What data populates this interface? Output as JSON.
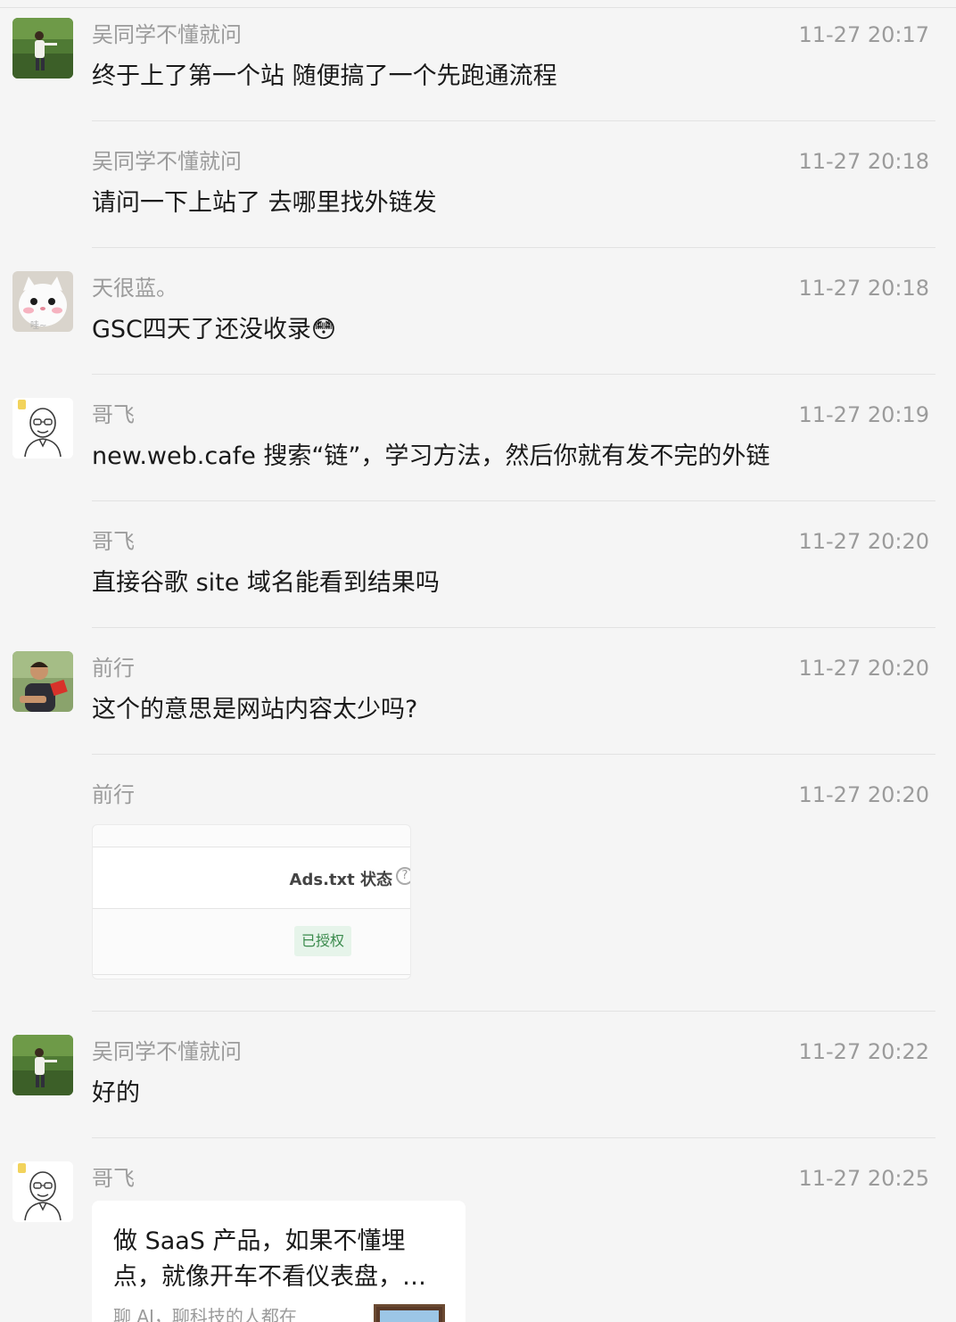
{
  "messages": [
    {
      "sender": "吴同学不懂就问",
      "time": "11-27 20:17",
      "text": "终于上了第一个站 随便搞了一个先跑通流程",
      "avatar": "photo-avatar-wu"
    },
    {
      "sender": "吴同学不懂就问",
      "time": "11-27 20:18",
      "text": "请问一下上站了 去哪里找外链发"
    },
    {
      "sender": "天很蓝。",
      "time": "11-27 20:18",
      "text": "GSC四天了还没收录",
      "emoji": "😳",
      "avatar": "cat-avatar"
    },
    {
      "sender": "哥飞",
      "time": "11-27 20:19",
      "text": "new.web.cafe 搜索“链”，学习方法，然后你就有发不完的外链",
      "avatar": "cartoon-avatar-gefei"
    },
    {
      "sender": "哥飞",
      "time": "11-27 20:20",
      "text": "直接谷歌 site 域名能看到结果吗"
    },
    {
      "sender": "前行",
      "time": "11-27 20:20",
      "text": "这个的意思是网站内容太少吗?",
      "avatar": "photo-avatar-qianxing"
    },
    {
      "sender": "前行",
      "time": "11-27 20:20",
      "image": {
        "label": "Ads.txt 状态",
        "badge": "已授权"
      }
    },
    {
      "sender": "吴同学不懂就问",
      "time": "11-27 20:22",
      "text": "好的",
      "avatar": "photo-avatar-wu"
    },
    {
      "sender": "哥飞",
      "time": "11-27 20:25",
      "avatar": "cartoon-avatar-gefei",
      "link": {
        "title": "做 SaaS 产品，如果不懂埋点，就像开车不看仪表盘，…",
        "source": "聊 AI，聊科技的人都在"
      }
    }
  ],
  "cat_avatar_caption": "哇~",
  "colors": {
    "background": "#f5f5f5",
    "meta_text": "#9b9b9b",
    "body_text": "#1a1a1a",
    "divider": "#e2e2e2",
    "badge_bg": "#e6f4ea",
    "badge_text": "#3a8a4c"
  }
}
